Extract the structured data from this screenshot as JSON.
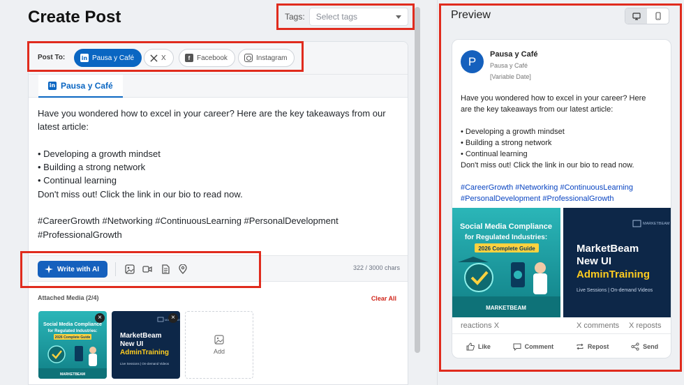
{
  "page": {
    "title": "Create Post",
    "tags_label": "Tags:",
    "tags_placeholder": "Select tags"
  },
  "post_to": {
    "label": "Post To:",
    "channels": [
      {
        "label": "Pausa y Café",
        "icon": "linkedin-icon",
        "selected": true
      },
      {
        "label": "X",
        "icon": "x-icon",
        "selected": false
      },
      {
        "label": "Facebook",
        "icon": "facebook-icon",
        "selected": false
      },
      {
        "label": "Instagram",
        "icon": "instagram-icon",
        "selected": false
      }
    ]
  },
  "editor": {
    "active_tab": "Pausa y Café",
    "lines": [
      "Have you wondered how to excel in your career? Here are the key takeaways from our",
      "latest article:",
      "",
      "• Developing a growth mindset",
      "• Building a strong network",
      "• Continual learning",
      "Don't miss out! Click the link in our bio to read now.",
      "",
      "#CareerGrowth #Networking #ContinuousLearning #PersonalDevelopment",
      "#ProfessionalGrowth"
    ],
    "ai_button": "Write with AI",
    "toolbar_icons": [
      "image-icon",
      "video-icon",
      "document-icon",
      "location-pin-icon"
    ],
    "char_count": "322 / 3000 chars"
  },
  "media": {
    "title": "Attached Media (2/4)",
    "clear_all": "Clear All",
    "add_label": "Add",
    "items": [
      {
        "kind": "compliance-guide",
        "lines": [
          "Social Media Compliance",
          "for Regulated Industries:",
          "2026 Complete Guide"
        ],
        "brand": "MARKETBEAM"
      },
      {
        "kind": "admin-training",
        "lines": [
          "MarketBeam",
          "New UI",
          "AdminTraining"
        ],
        "footer": "Live Sessions | On-demand Videos",
        "corner_logo": "MARKETBEAM"
      }
    ]
  },
  "preview": {
    "title": "Preview",
    "view_modes": [
      {
        "name": "desktop-icon",
        "active": true
      },
      {
        "name": "mobile-icon",
        "active": false
      }
    ],
    "avatar_letter": "P",
    "name": "Pausa y Café",
    "subtitle": "Pausa y Café",
    "date": "[Variable Date]",
    "text_lines": [
      "Have you wondered how to excel in your career? Here",
      "are the key takeaways from our latest article:",
      "",
      "• Developing a growth mindset",
      "• Building a strong network",
      "• Continual learning",
      "Don't miss out! Click the link in our bio to read now.",
      ""
    ],
    "hashtag_lines": [
      "#CareerGrowth #Networking #ContinuousLearning",
      "#PersonalDevelopment #ProfessionalGrowth"
    ],
    "reactions": "reactions X",
    "comments": "X comments",
    "reposts": "X reposts",
    "actions": [
      {
        "label": "Like",
        "icon": "thumbs-up-icon"
      },
      {
        "label": "Comment",
        "icon": "comment-icon"
      },
      {
        "label": "Repost",
        "icon": "repost-icon"
      },
      {
        "label": "Send",
        "icon": "share-icon"
      }
    ]
  },
  "colors": {
    "brand_blue": "#0a66c2",
    "highlight_red": "#e02b1d",
    "hashtag_blue": "#0a45c2",
    "clear_red": "#d0261b"
  }
}
